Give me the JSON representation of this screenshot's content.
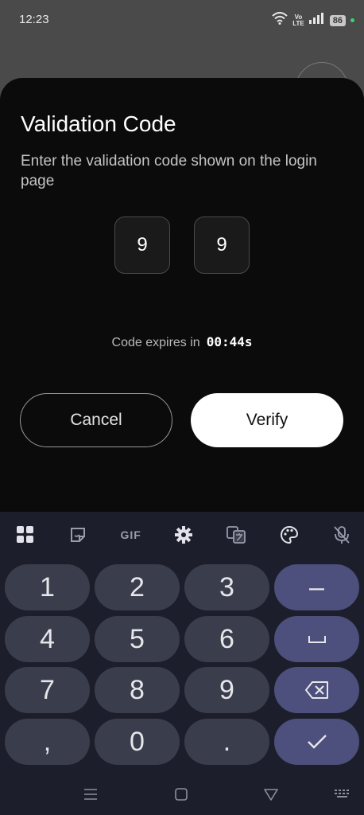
{
  "status_bar": {
    "time": "12:23",
    "volte_top": "Vo",
    "volte_bottom": "LTE",
    "battery": "86"
  },
  "dialog": {
    "title": "Validation Code",
    "subtitle": "Enter the validation code shown on the login page",
    "code_digits": [
      "9",
      "9"
    ],
    "expires_label": "Code expires in",
    "expires_timer": "00:44s",
    "cancel_label": "Cancel",
    "verify_label": "Verify"
  },
  "keyboard": {
    "toolbar": {
      "gif_label": "GIF"
    },
    "keys": {
      "k1": "1",
      "k2": "2",
      "k3": "3",
      "minus": "–",
      "k4": "4",
      "k5": "5",
      "k6": "6",
      "k7": "7",
      "k8": "8",
      "k9": "9",
      "comma": ",",
      "k0": "0",
      "period": "."
    }
  },
  "colors": {
    "sheet": "#0b0b0b",
    "keyboard": "#1c1f2b",
    "key": "#3a3d4c",
    "action_key": "#4d4f7c",
    "verify_button": "#ffffff"
  }
}
